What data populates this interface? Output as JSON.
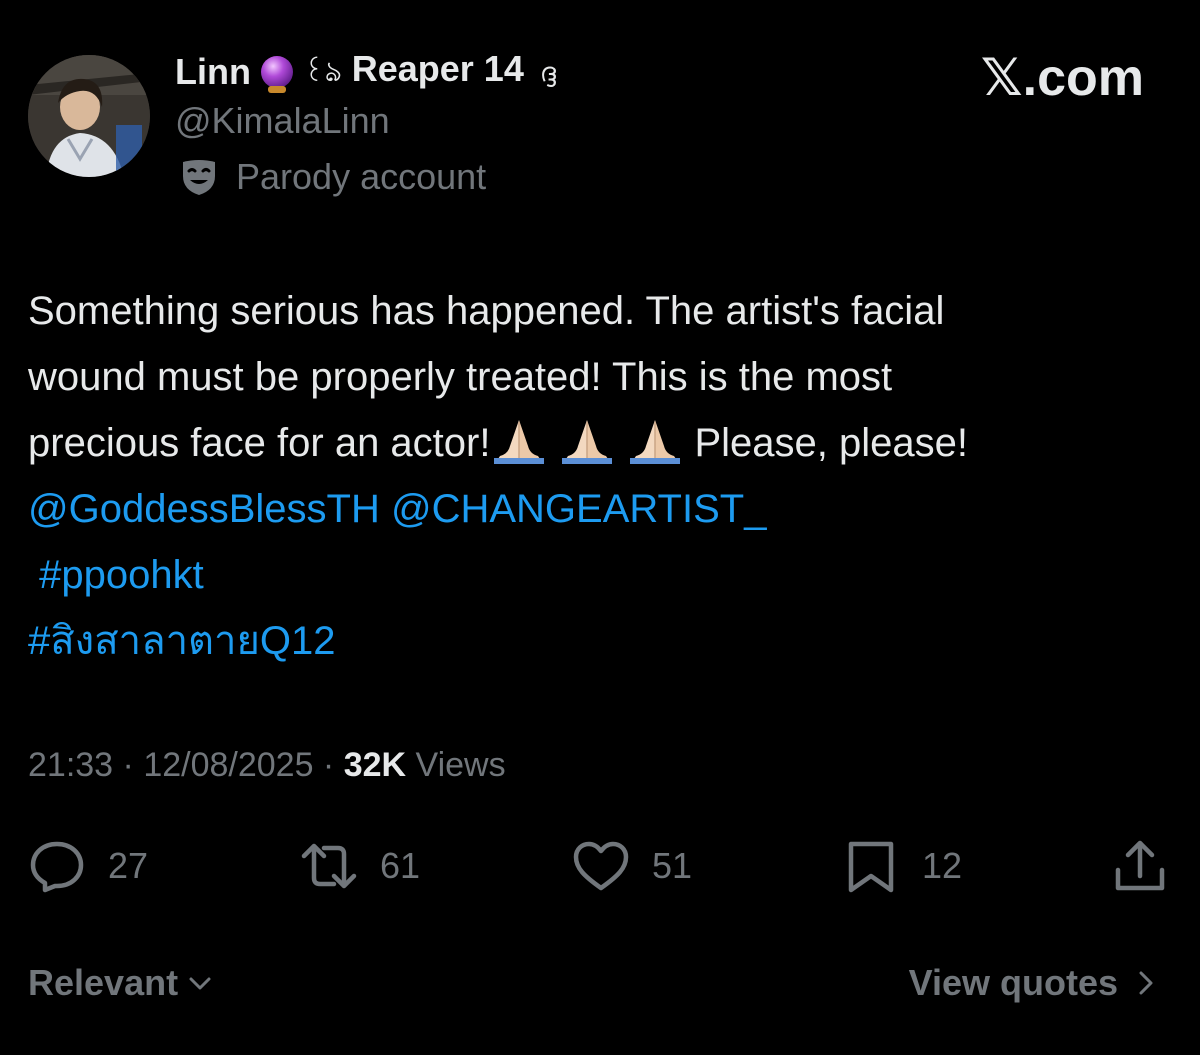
{
  "author": {
    "display_name": "Linn",
    "name_glyph_left": "꒰ঌ",
    "name_suffix": "Reaper 14",
    "name_glyph_right": "ദ്ദ",
    "handle": "@KimalaLinn",
    "label": "Parody account"
  },
  "brand": "𝕏.com",
  "tweet": {
    "line1": "Something serious has happened. The artist's facial",
    "line2": "wound must be properly treated! This is the most",
    "line3": "precious face for an actor!",
    "line3_after": "Please, please!",
    "mention1": "@GoddessBlessTH",
    "mention2": "@CHANGEARTIST_",
    "hashtag1": " #ppoohkt",
    "hashtag2": "#สิงสาลาตายQ12"
  },
  "meta": {
    "time": "21:33",
    "sep": " · ",
    "date": "12/08/2025",
    "views_count": "32K",
    "views_label": "Views"
  },
  "actions": {
    "replies": "27",
    "reposts": "61",
    "likes": "51",
    "bookmarks": "12"
  },
  "footer": {
    "sort_label": "Relevant",
    "quotes_label": "View quotes"
  },
  "colors": {
    "background": "#000000",
    "text": "#e7e9ea",
    "secondary": "#71767b",
    "link": "#1d9bf0"
  }
}
